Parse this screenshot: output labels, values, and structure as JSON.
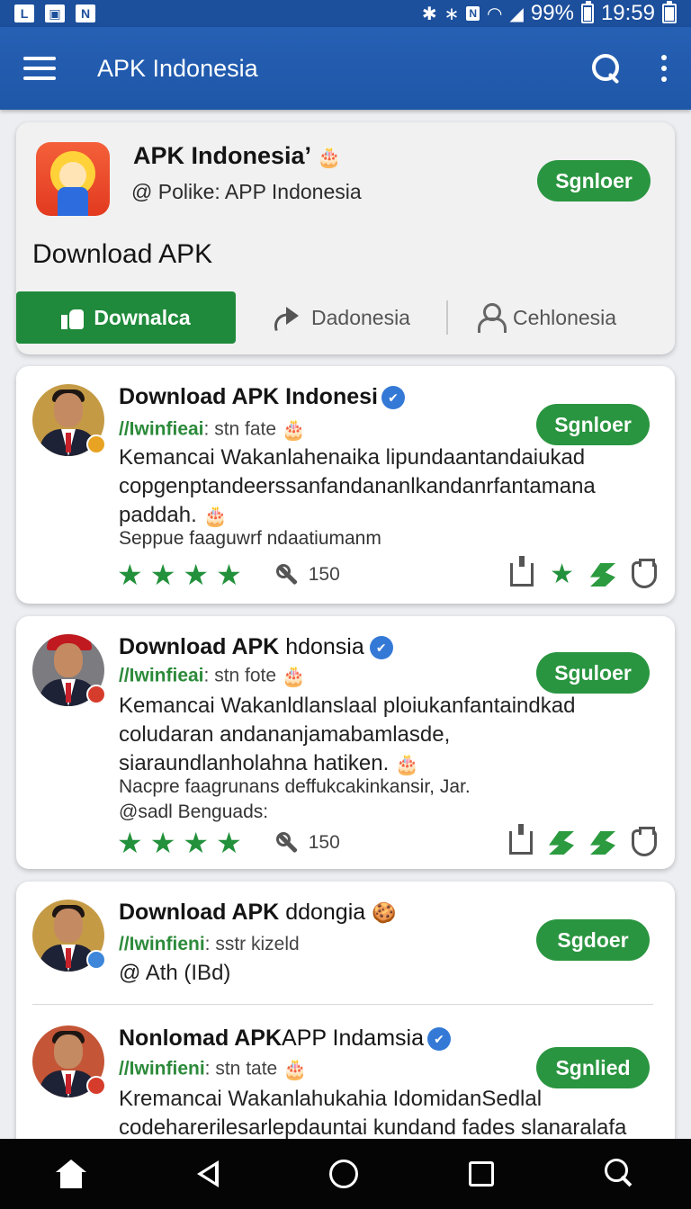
{
  "status_bar": {
    "battery": "99%",
    "time": "19:59"
  },
  "app_bar": {
    "title": "APK Indonesia"
  },
  "profile": {
    "name": "APK Indonesia’",
    "sub": "@ Polike: APP Indonesia",
    "follow_label": "Sgnloer",
    "section_title": "Download APK",
    "tabs": [
      "Downalca",
      "Dadonesia",
      "Cehlonesia"
    ]
  },
  "posts": [
    {
      "name_bold": "Download APK Indonesi",
      "name_rest": "",
      "handle_green": "//Iwinfieai",
      "handle_rest": ": stn  fate",
      "follow_label": "Sgnloer",
      "body": "Kemancai Wakanlahenaika lipundaantandaiukad copgenptandeerssanfandananlkandanrfantamana paddah.",
      "meta": [
        "Seppue faaguwrf ndaatiumanm"
      ],
      "replies": "150"
    },
    {
      "name_bold": "Download APK",
      "name_rest": " hdonsia",
      "handle_green": "//Iwinfieai",
      "handle_rest": ": stn  fote",
      "follow_label": "Sguloer",
      "body": "Kemancai Wakanldlanslaal ploiukanfantaindkad coludaran andananjamabamlasde, siaraundlanholahna hatiken.",
      "meta": [
        "Nacpre faagrunans deffukcakinkansir, Jar.",
        "@sadl Benguads:"
      ],
      "replies": "150"
    },
    {
      "name_bold": "Download APK",
      "name_rest": " ddongia",
      "handle_green": "//Iwinfieni",
      "handle_rest": ": sstr  kizeld",
      "follow_label": "Sgdoer",
      "body": "@  Ath (IBd)",
      "meta": [],
      "replies": ""
    },
    {
      "name_bold": "Nonlomad APK",
      "name_rest": "APP Indamsia",
      "handle_green": "//Iwinfieni",
      "handle_rest": ": stn  tate",
      "follow_label": "Sgnlied",
      "body": "Kremancai Wakanlahukahia IdomidanSedlal codeharerilesarlepdauntai kundand fades slanaralafa",
      "meta": [],
      "replies": ""
    }
  ],
  "colors": {
    "app_bar": "#2660b4",
    "accent_green": "#2a9540",
    "nav": "#050505"
  },
  "icons": [
    "menu-icon",
    "search-icon",
    "more-icon",
    "verified-icon",
    "star-icon",
    "retweet-icon",
    "shield-icon",
    "home-icon",
    "back-icon",
    "recents-icon"
  ]
}
